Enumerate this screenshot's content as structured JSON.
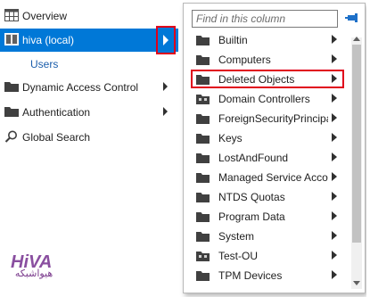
{
  "nav": {
    "items": [
      {
        "label": "Overview",
        "icon": "overview-icon"
      },
      {
        "label": "hiva (local)",
        "icon": "domain-icon",
        "selected": true
      },
      {
        "label": "Dynamic Access Control",
        "icon": "folder-icon",
        "has_arrow": true
      },
      {
        "label": "Authentication",
        "icon": "folder-icon",
        "has_arrow": true
      },
      {
        "label": "Global Search",
        "icon": "search-icon"
      }
    ],
    "sub_item": "Users"
  },
  "logo": {
    "brand": "HiVA",
    "text": "هیواشبکه"
  },
  "column": {
    "search_placeholder": "Find in this column",
    "items": [
      {
        "label": "Builtin",
        "icon": "folder-icon"
      },
      {
        "label": "Computers",
        "icon": "folder-icon"
      },
      {
        "label": "Deleted Objects",
        "icon": "folder-icon",
        "highlighted": true
      },
      {
        "label": "Domain Controllers",
        "icon": "ou-icon"
      },
      {
        "label": "ForeignSecurityPrincipals",
        "icon": "folder-icon"
      },
      {
        "label": "Keys",
        "icon": "folder-icon"
      },
      {
        "label": "LostAndFound",
        "icon": "folder-icon"
      },
      {
        "label": "Managed Service Accounts",
        "icon": "folder-icon"
      },
      {
        "label": "NTDS Quotas",
        "icon": "folder-icon"
      },
      {
        "label": "Program Data",
        "icon": "folder-icon"
      },
      {
        "label": "System",
        "icon": "folder-icon"
      },
      {
        "label": "Test-OU",
        "icon": "ou-icon"
      },
      {
        "label": "TPM Devices",
        "icon": "folder-icon"
      }
    ]
  },
  "colors": {
    "selection": "#0078d7",
    "highlight_border": "#e0001b",
    "folder": "#404040"
  }
}
